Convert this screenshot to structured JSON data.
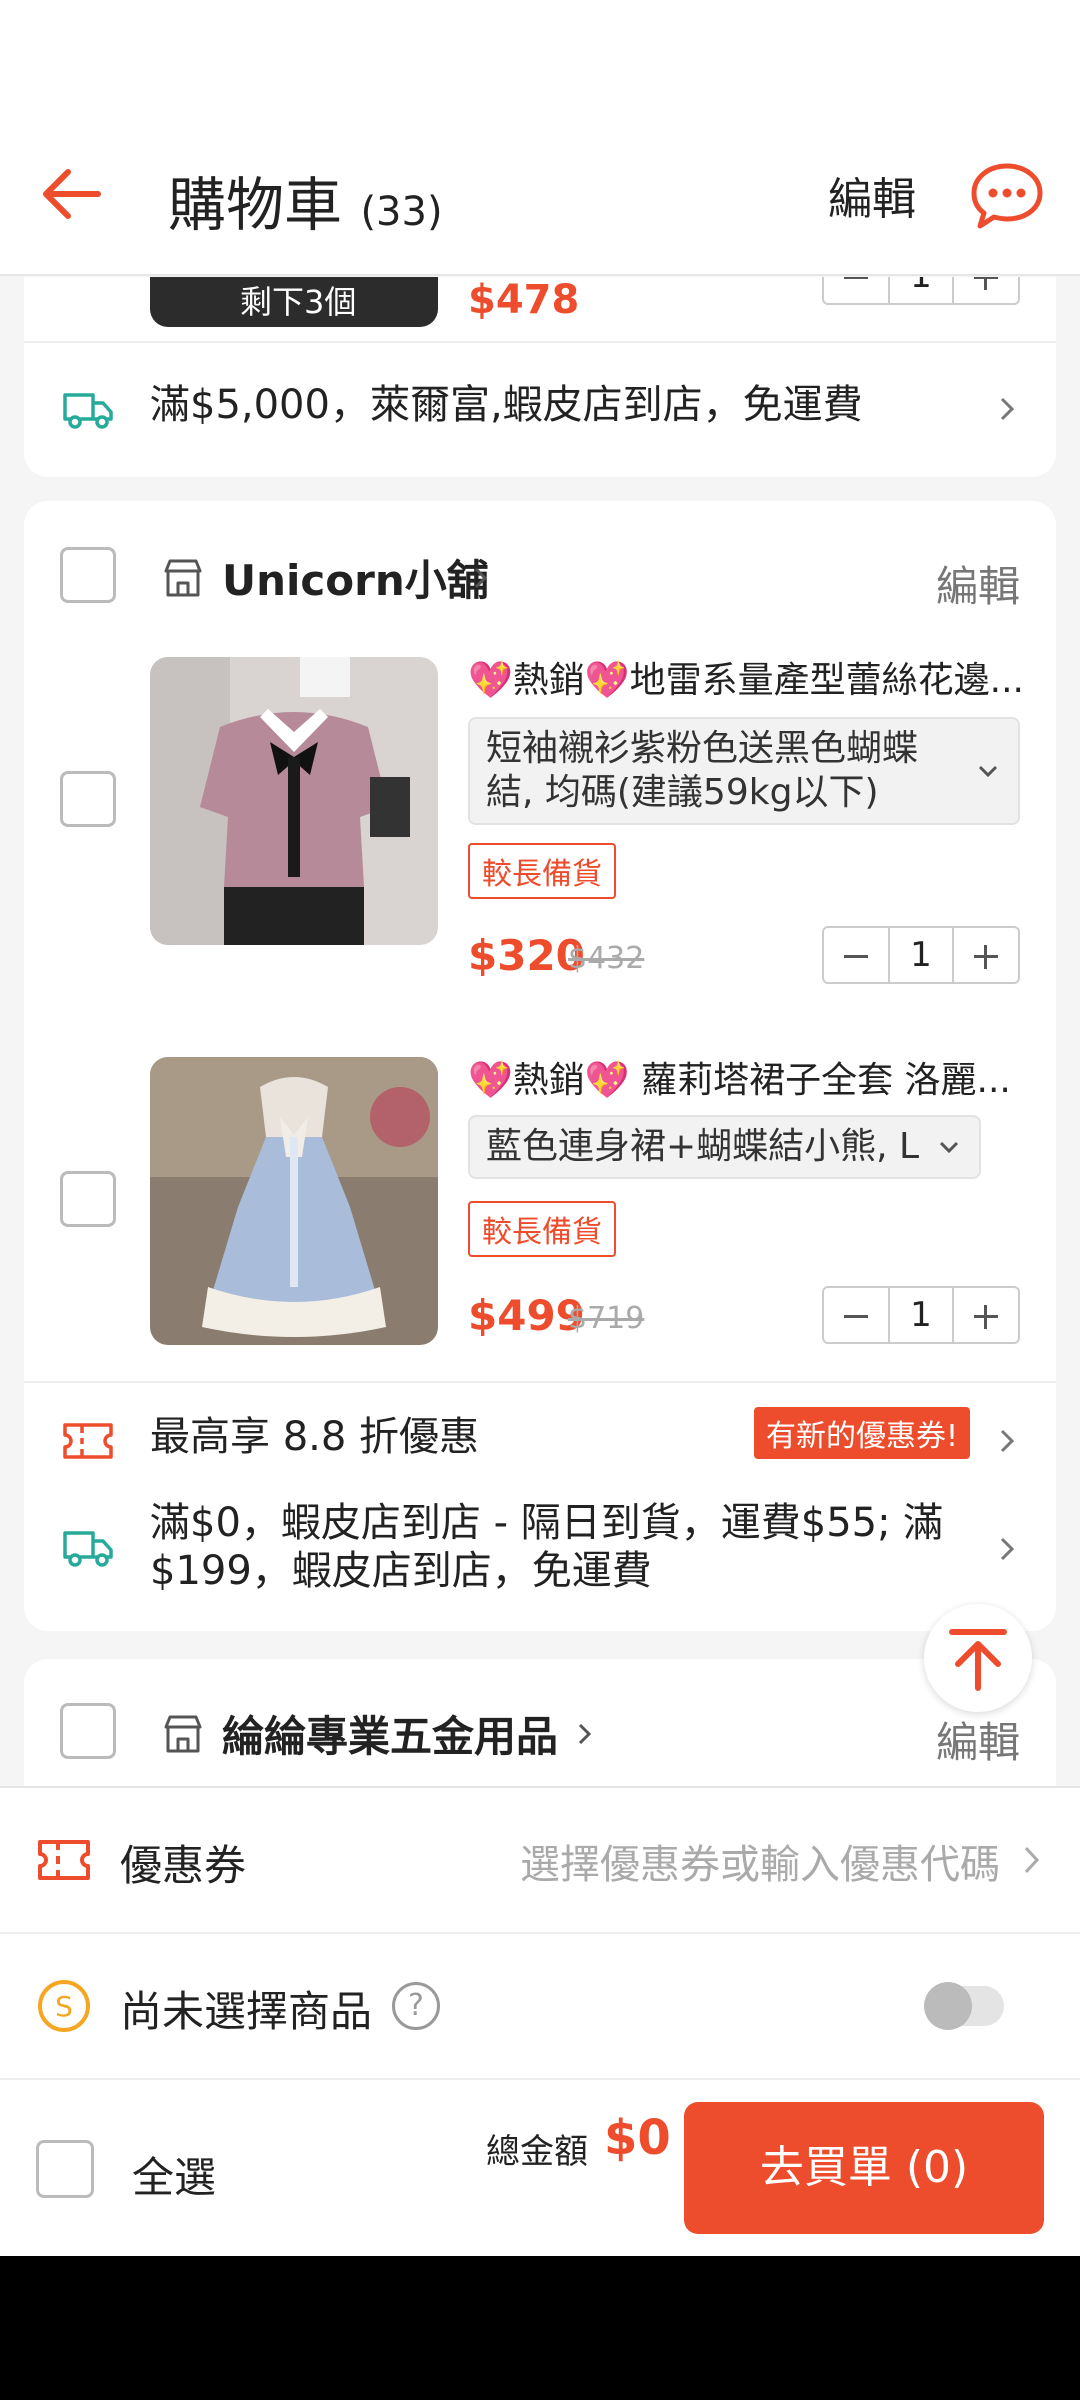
{
  "header": {
    "title": "購物車",
    "count": "(33)",
    "edit_label": "編輯"
  },
  "shop_prev": {
    "partial_label": "剩下3個",
    "partial_price": "$478",
    "qty": "1",
    "shipping_promo": "滿$5,000，萊爾富,蝦皮店到店，免運費"
  },
  "shop_unicorn": {
    "name": "Unicorn小舖",
    "edit_label": "編輯",
    "items": [
      {
        "title": "💖熱銷💖地雷系量產型蕾絲花邊...",
        "variation": "短袖襯衫紫粉色送黑色蝴蝶結, 均碼(建議59kg以下)",
        "badge": "較長備貨",
        "price": "$320",
        "price_old": "$432",
        "qty": "1"
      },
      {
        "title": "💖熱銷💖 蘿莉塔裙子全套 洛麗...",
        "variation": "藍色連身裙+蝴蝶結小熊, L",
        "badge": "較長備貨",
        "price": "$499",
        "price_old": "$719",
        "qty": "1"
      }
    ],
    "discount_text": "最高享 8.8 折優惠",
    "discount_badge": "有新的優惠券!",
    "shipping_text": "滿$0，蝦皮店到店 - 隔日到貨，運費$55; 滿$199，蝦皮店到店，免運費"
  },
  "shop_next": {
    "name": "綸綸專業五金用品",
    "edit_label": "編輯"
  },
  "bottom": {
    "voucher_label": "優惠券",
    "voucher_placeholder": "選擇優惠券或輸入優惠代碼",
    "coins_label": "尚未選擇商品",
    "help_symbol": "?",
    "select_all_label": "全選",
    "total_label": "總金額",
    "total_value": "$0",
    "checkout_label": "去買單 (0)"
  },
  "colors": {
    "accent": "#ee4d2d",
    "teal": "#26aa99"
  },
  "icons": [
    "back-arrow-icon",
    "chat-icon",
    "truck-icon",
    "shop-icon",
    "chevron-right-icon",
    "chevron-down-icon",
    "voucher-icon",
    "coin-icon",
    "help-icon",
    "arrow-up-icon"
  ]
}
